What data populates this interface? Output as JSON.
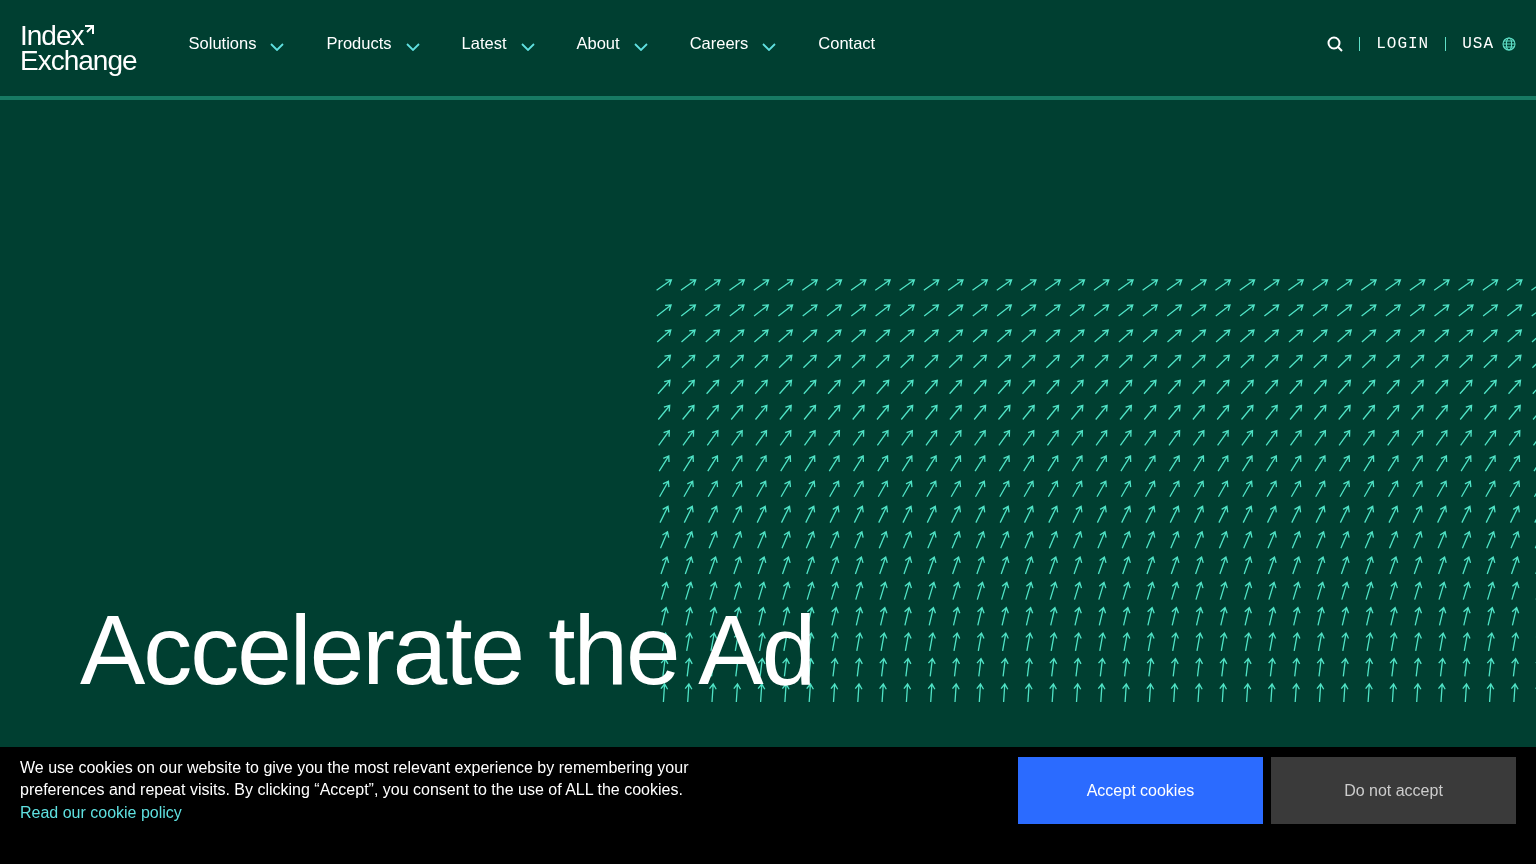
{
  "logo": {
    "line_1": "Index",
    "line_2": "Exchange"
  },
  "nav": [
    {
      "label": "Solutions",
      "has_menu": true
    },
    {
      "label": "Products",
      "has_menu": true
    },
    {
      "label": "Latest",
      "has_menu": true
    },
    {
      "label": "About",
      "has_menu": true
    },
    {
      "label": "Careers",
      "has_menu": true
    },
    {
      "label": "Contact",
      "has_menu": false
    }
  ],
  "utility": {
    "login": "LOGIN",
    "region": "USA"
  },
  "hero": {
    "heading": "Accelerate the Ad"
  },
  "cookie_banner": {
    "text": "We use cookies on our website to give you the most relevant experience by remembering your preferences and repeat visits. By clicking “Accept”, you consent to the use of ALL the cookies.",
    "link": "Read our cookie policy",
    "accept": "Accept cookies",
    "decline": "Do not accept"
  }
}
